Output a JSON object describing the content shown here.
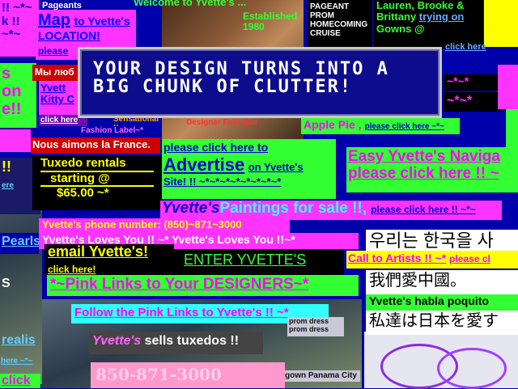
{
  "banner": {
    "line1": "YOUR DESIGN TURNS INTO A",
    "line2": "BIG CHUNK OF CLUTTER!"
  },
  "top": {
    "pageants": "Pageants",
    "welcome": "Welcome to  Yvette's ...",
    "established": "Established 1980",
    "pageant_list": [
      "PAGEANT",
      "PROM",
      "HOMECOMING",
      "CRUISE"
    ],
    "laurel": "Lauren, Brooke &",
    "brittany": "Brittany",
    "trying_on": "trying on",
    "gowns": "Gowns @",
    "yvettes_small": "Yvette's",
    "click_here": "click here"
  },
  "left": {
    "clk": "!! ~*~",
    "k_line": "k !!  ~*~",
    "s": "s",
    "on": "on",
    "e": "e!!",
    "exclaim": "!!",
    "ere": "ere",
    "pearls": "Pearls,",
    "s2": "S",
    "realis": "realis",
    "here": "here ~*~",
    "click": "click"
  },
  "map": {
    "map": "Map",
    "to": "to Yvette's",
    "location": "LOCATION!",
    "please": "please"
  },
  "russian": "Мы люб",
  "kitty": {
    "line1": "Yvett",
    "line2": "Kitty C"
  },
  "sensational": "Sensational !!",
  "fashion": "Fashion Label~*",
  "designer_fabrique": "Designer Fabrique",
  "french": "Nous aimons la France.",
  "tuxedo": {
    "line1": "Tuxedo rentals",
    "line2": "starting @",
    "line3": "$65.00 ~*"
  },
  "apple": {
    "text": "Apple Pie ,",
    "link": "please click here ~*~"
  },
  "stars_right": [
    "~*~*",
    "~*~*"
  ],
  "advertise": {
    "line1": "please click here to",
    "line2": "Advertise",
    "line3": "on Yvette's",
    "line4": "Site! !! ~*~*~*~*~*~*~*~*"
  },
  "navigation": {
    "line1": "Easy Yvette's Naviga",
    "line2": "please click here !! ~"
  },
  "paintings": {
    "name": "Yvette's",
    "text": "Paintings for sale !!,",
    "link": "please click here !! ~*~"
  },
  "phone": "Yvette's phone number: (850)~871~3000",
  "loves": "Yvette's Loves You !! ~* Yvette's Loves You !!~*",
  "email": {
    "line1": "email Yvette's!",
    "line2": "click here!"
  },
  "enter": "ENTER YVETTE'S",
  "pink_links": "*~Pink Links to Your DESIGNERS~*",
  "follow": "Follow the Pink Links to Yvette's !! ~*",
  "sells": {
    "name": "Yvette's",
    "text": "sells tuxedos !!"
  },
  "phone_sign": "850-871-3000",
  "prom_dress": [
    "prom dress",
    "prom dress"
  ],
  "panama": "gown Panama City",
  "korean": "우리는 한국을 사",
  "artists": {
    "text": "Call to Artists !! ~*",
    "link": "please cl"
  },
  "chinese": "我們愛中國。",
  "spanish": "Yvette's habla poquito",
  "japanese": "私達は日本を愛す",
  "colors": {
    "bg": "#0000aa",
    "green": "#33ff33",
    "magenta": "#ff33ff",
    "yellow": "#ffff00",
    "cyan": "#00ffff"
  }
}
